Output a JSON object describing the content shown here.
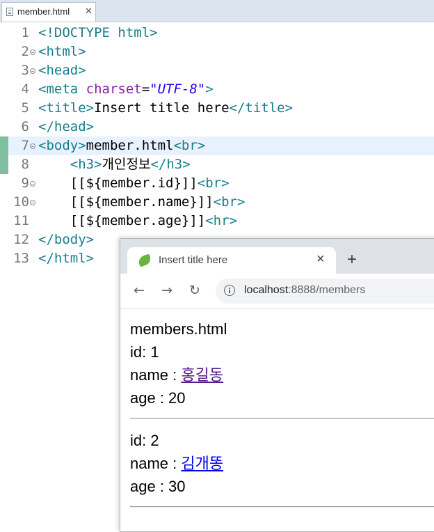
{
  "editor": {
    "tab": {
      "filename": "member.html",
      "close_glyph": "✕"
    },
    "lines": [
      {
        "num": "1",
        "fold": false,
        "tokens": [
          {
            "c": "t",
            "s": "<!DOCTYPE html>"
          }
        ]
      },
      {
        "num": "2",
        "fold": true,
        "tokens": [
          {
            "c": "t",
            "s": "<html>"
          }
        ]
      },
      {
        "num": "3",
        "fold": true,
        "tokens": [
          {
            "c": "t",
            "s": "<head>"
          }
        ]
      },
      {
        "num": "4",
        "fold": false,
        "tokens": [
          {
            "c": "t",
            "s": "<meta "
          },
          {
            "c": "an",
            "s": "charset"
          },
          {
            "c": "eq",
            "s": "="
          },
          {
            "c": "av",
            "s": "\"UTF-8\""
          },
          {
            "c": "t",
            "s": ">"
          }
        ]
      },
      {
        "num": "5",
        "fold": false,
        "tokens": [
          {
            "c": "t",
            "s": "<title>"
          },
          {
            "c": "tx",
            "s": "Insert title here"
          },
          {
            "c": "t",
            "s": "</title>"
          }
        ]
      },
      {
        "num": "6",
        "fold": false,
        "tokens": [
          {
            "c": "t",
            "s": "</head>"
          }
        ]
      },
      {
        "num": "7",
        "fold": true,
        "current": true,
        "changed": true,
        "tokens": [
          {
            "c": "t",
            "s": "<body>"
          },
          {
            "c": "tx",
            "s": "member.html"
          },
          {
            "c": "t",
            "s": "<br>"
          }
        ]
      },
      {
        "num": "8",
        "fold": false,
        "changed": true,
        "tokens": [
          {
            "c": "tx",
            "s": "    "
          },
          {
            "c": "t",
            "s": "<h3>"
          },
          {
            "c": "tx",
            "s": "개인정보"
          },
          {
            "c": "t",
            "s": "</h3>"
          }
        ]
      },
      {
        "num": "9",
        "fold": true,
        "tokens": [
          {
            "c": "tx",
            "s": "    [[${member.id}]]"
          },
          {
            "c": "t",
            "s": "<br>"
          }
        ]
      },
      {
        "num": "10",
        "fold": true,
        "tokens": [
          {
            "c": "tx",
            "s": "    [[${member.name}]]"
          },
          {
            "c": "t",
            "s": "<br>"
          }
        ]
      },
      {
        "num": "11",
        "fold": false,
        "tokens": [
          {
            "c": "tx",
            "s": "    [[${member.age}]]"
          },
          {
            "c": "t",
            "s": "<hr>"
          }
        ]
      },
      {
        "num": "12",
        "fold": false,
        "tokens": [
          {
            "c": "t",
            "s": "</body>"
          }
        ]
      },
      {
        "num": "13",
        "fold": false,
        "tokens": [
          {
            "c": "t",
            "s": "</html>"
          }
        ]
      }
    ]
  },
  "browser": {
    "tab_title": "Insert title here",
    "tab_close": "×",
    "new_tab": "+",
    "back": "←",
    "forward": "→",
    "reload": "↻",
    "url_host": "localhost",
    "url_rest": ":8888/members",
    "page": {
      "heading": "members.html",
      "members": [
        {
          "id_text": "id: 1",
          "name_label": "name : ",
          "name": "홍길동",
          "visited": true,
          "age_text": "age : 20"
        },
        {
          "id_text": "id: 2",
          "name_label": "name : ",
          "name": "김개똥",
          "visited": false,
          "age_text": "age : 30"
        }
      ]
    }
  },
  "colors": {
    "tag": "#177e89",
    "attr_name": "#8a1ea8",
    "attr_value": "#2a00ff",
    "link": "#0000ee",
    "link_visited": "#551a8b",
    "current_line": "#e8f2fe",
    "change_marker": "#7fbf9f"
  }
}
